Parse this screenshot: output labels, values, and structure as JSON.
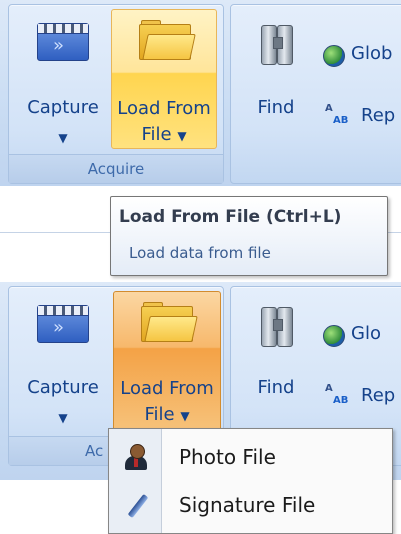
{
  "ribbon_top": {
    "capture_label": "Capture",
    "load_label_line1": "Load From",
    "load_label_line2": "File",
    "group_label": "Acquire",
    "find_label": "Find",
    "side_top": "Glob",
    "side_bottom": "Rep"
  },
  "tooltip": {
    "title": "Load From File (Ctrl+L)",
    "description": "Load data from file"
  },
  "ribbon_bottom": {
    "capture_label": "Capture",
    "load_label_line1": "Load From",
    "load_label_line2": "File",
    "group_label_partial": "Ac",
    "find_label": "Find",
    "side_top": "Glo",
    "side_bottom": "Rep"
  },
  "menu": {
    "items": [
      {
        "label": "Photo File",
        "icon": "person-icon"
      },
      {
        "label": "Signature File",
        "icon": "pen-icon"
      }
    ]
  },
  "icons": {
    "capture": "film-capture-icon",
    "load": "folder-icon",
    "find": "binoculars-icon",
    "global": "globe-icon",
    "replace": "replace-icon"
  },
  "colors": {
    "ribbon_text": "#15428b",
    "hover_yellow": "#ffd54f",
    "pressed_orange": "#f4a246"
  }
}
